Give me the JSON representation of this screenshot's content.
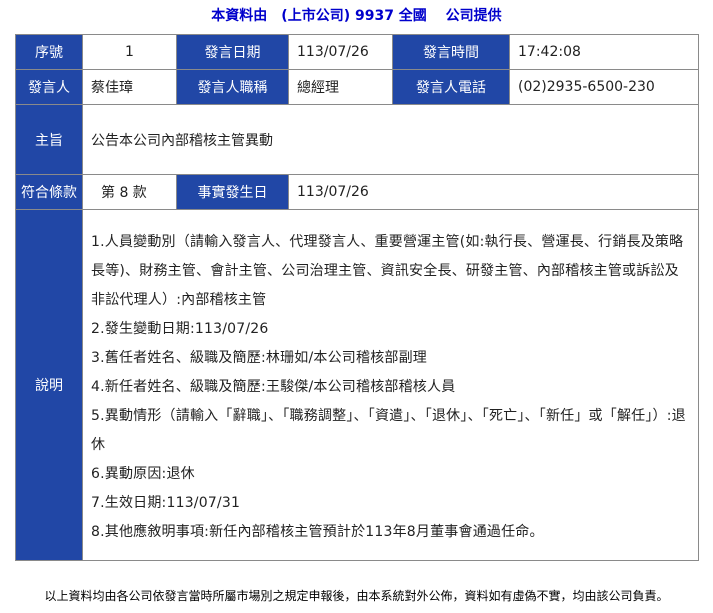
{
  "header": {
    "text": "本資料由　(上市公司) 9937 全國　 公司提供"
  },
  "row1": {
    "seq_label": "序號",
    "seq_value": "1",
    "date_label": "發言日期",
    "date_value": "113/07/26",
    "time_label": "發言時間",
    "time_value": "17:42:08"
  },
  "row2": {
    "speaker_label": "發言人",
    "speaker_value": "蔡佳璋",
    "title_label": "發言人職稱",
    "title_value": "總經理",
    "phone_label": "發言人電話",
    "phone_value": "(02)2935-6500-230"
  },
  "subject": {
    "label": "主旨",
    "value": "公告本公司內部稽核主管異動"
  },
  "row4": {
    "clause_label": "符合條款",
    "clause_value": "第 8 款",
    "event_date_label": "事實發生日",
    "event_date_value": "113/07/26"
  },
  "description": {
    "label": "說明",
    "lines": [
      "1.人員變動別（請輸入發言人、代理發言人、重要營運主管(如:執行長、營運長、行銷長及策略長等)、財務主管、會計主管、公司治理主管、資訊安全長、研發主管、內部稽核主管或訴訟及非訟代理人）:內部稽核主管",
      "2.發生變動日期:113/07/26",
      "3.舊任者姓名、級職及簡歷:林珊如/本公司稽核部副理",
      "4.新任者姓名、級職及簡歷:王駿傑/本公司稽核部稽核人員",
      "5.異動情形（請輸入「辭職」、「職務調整」、「資遣」、「退休」、「死亡」、「新任」或「解任」）:退休",
      "6.異動原因:退休",
      "7.生效日期:113/07/31",
      "8.其他應敘明事項:新任內部稽核主管預計於113年8月董事會通過任命。"
    ]
  },
  "footer": {
    "text": "以上資料均由各公司依發言當時所屬市場別之規定申報後，由本系統對外公佈，資料如有虛偽不實，均由該公司負責。"
  },
  "colors": {
    "label_bg": "#2147a6",
    "header_text": "#0000cc"
  }
}
